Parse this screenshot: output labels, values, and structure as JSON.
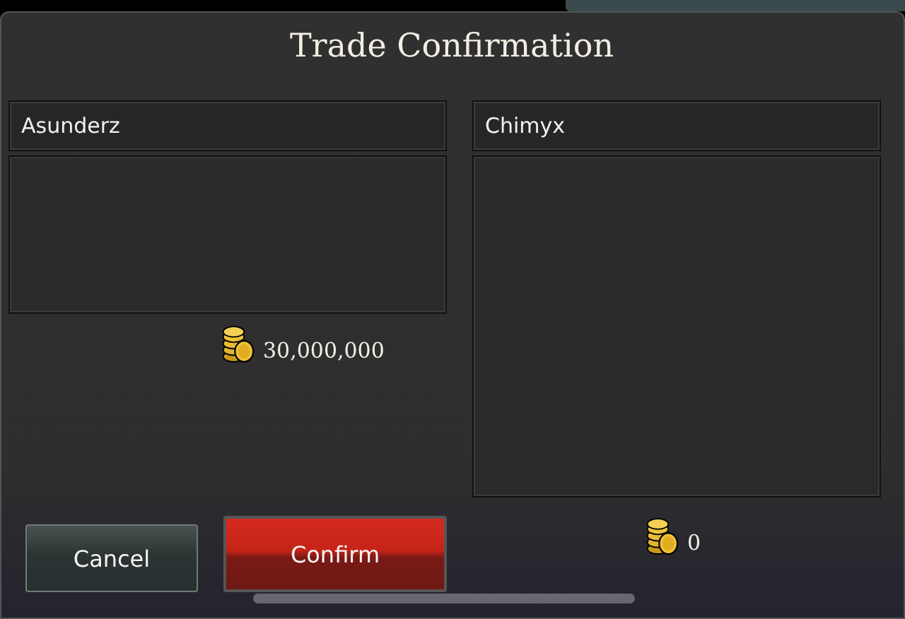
{
  "dialog": {
    "title": "Trade Confirmation"
  },
  "parties": [
    {
      "name": "Asunderz",
      "gold": "30,000,000"
    },
    {
      "name": "Chimyx",
      "gold": "0"
    }
  ],
  "buttons": [
    {
      "label": "Cancel",
      "kind": "cancel"
    },
    {
      "label": "Confirm",
      "kind": "confirm"
    }
  ]
}
